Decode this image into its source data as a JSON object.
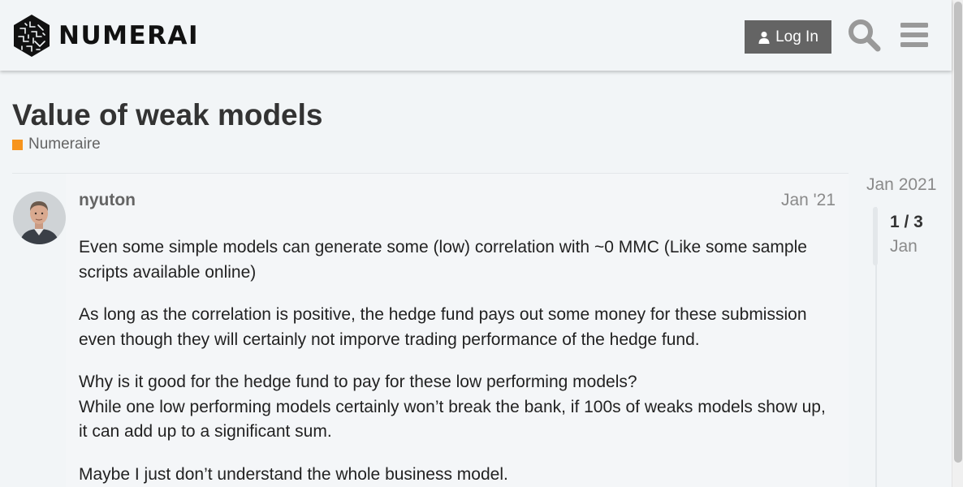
{
  "header": {
    "brand": "NUMERAI",
    "login_label": "Log In",
    "icons": [
      "numerai-logo-icon",
      "user-icon",
      "search-icon",
      "hamburger-menu-icon"
    ]
  },
  "topic": {
    "title": "Value of weak models",
    "category": {
      "label": "Numeraire",
      "color": "#f7941d"
    }
  },
  "post": {
    "username": "nyuton",
    "date": "Jan '21",
    "paragraphs": [
      [
        "Even some simple models can generate some (low) correlation with ~0 MMC (Like some sample scripts available online)"
      ],
      [
        "As long as the correlation is positive, the hedge fund pays out some money for these submission even though they will certainly not imporve trading performance of the hedge fund."
      ],
      [
        "Why is it good for the hedge fund to pay for these low performing models?",
        "While one low performing models certainly won’t break the bank, if 100s of weaks models show up, it can add up to a significant sum."
      ],
      [
        "Maybe I just don’t understand the whole business model."
      ]
    ]
  },
  "timeline": {
    "start_date": "Jan 2021",
    "position": "1 / 3",
    "current_date": "Jan"
  },
  "colors": {
    "background": "#f2f5f7",
    "button": "#646464",
    "title": "#333333",
    "muted": "#8a8a8a"
  }
}
